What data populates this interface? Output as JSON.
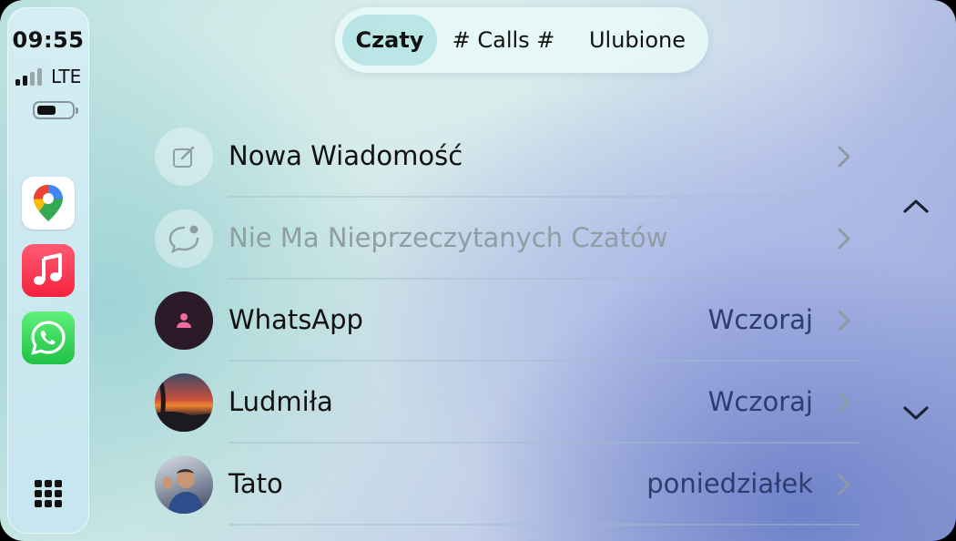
{
  "status": {
    "time": "09:55",
    "network": "LTE",
    "signal_bars_active": 2,
    "signal_bars_total": 4
  },
  "dock": {
    "apps": [
      {
        "name": "maps",
        "icon": "google-maps-icon"
      },
      {
        "name": "music",
        "icon": "music-note-icon"
      },
      {
        "name": "whatsapp",
        "icon": "whatsapp-icon"
      }
    ],
    "launcher_icon": "app-grid-icon"
  },
  "tabs": [
    {
      "label": "Czaty",
      "active": true
    },
    {
      "label": "# Calls #",
      "active": false
    },
    {
      "label": "Ulubione",
      "active": false
    }
  ],
  "list": {
    "rows": [
      {
        "title": "Nowa Wiadomość",
        "meta": "",
        "icon": "compose-icon"
      },
      {
        "title": "Nie Ma Nieprzeczytanych Czatów",
        "meta": "",
        "icon": "chat-bubble-icon",
        "muted": true
      },
      {
        "title": "WhatsApp",
        "meta": "Wczoraj",
        "icon": "person-icon"
      },
      {
        "title": "Ludmiła",
        "meta": "Wczoraj",
        "icon": "contact-photo"
      },
      {
        "title": "Tato",
        "meta": "poniedziałek",
        "icon": "contact-photo"
      }
    ]
  },
  "colors": {
    "accent_meta": "#2d3d70",
    "whatsapp_green": "#25d366",
    "music_red": "#f5223e"
  }
}
